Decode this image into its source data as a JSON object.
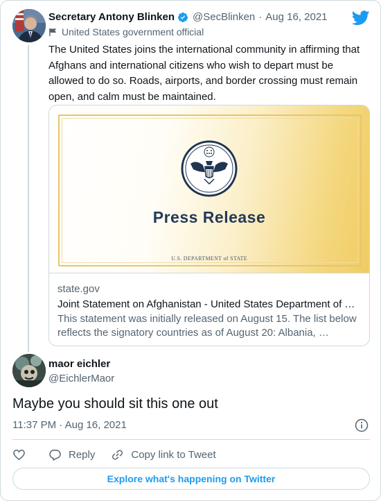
{
  "colors": {
    "brand_blue": "#1d9bf0",
    "text_primary": "#0f1419",
    "text_secondary": "#536471",
    "border": "#cfd9de",
    "press_navy": "#243a57",
    "frame_gold": "#e8c56b"
  },
  "parent_tweet": {
    "author_name": "Secretary Antony Blinken",
    "handle": "@SecBlinken",
    "date_prefix": "·",
    "date": "Aug 16, 2021",
    "verified_icon": "verified-badge-icon",
    "label_icon": "flag-icon",
    "label": "United States government official",
    "text": "The United States joins the international community in affirming that Afghans and international citizens who wish to depart must be allowed to do so. Roads, airports, and border crossing must remain open, and calm must be maintained.",
    "link_card": {
      "image_heading": "Press Release",
      "image_footer": "U.S. DEPARTMENT of STATE",
      "domain": "state.gov",
      "title": "Joint Statement on Afghanistan - United States Department of …",
      "description": "This statement was initially released on August 15. The list below reflects the signatory countries as of August 20:  Albania, …"
    }
  },
  "reply_tweet": {
    "author_name": "maor eichler",
    "handle": "@EichlerMaor",
    "text": "Maybe you should sit this one out",
    "timestamp": "11:37 PM · Aug 16, 2021",
    "info_icon": "info-icon"
  },
  "actions": {
    "like_icon": "heart-icon",
    "reply_icon": "reply-bubble-icon",
    "reply_label": "Reply",
    "copy_icon": "link-icon",
    "copy_label": "Copy link to Tweet"
  },
  "explore_button": "Explore what's happening on Twitter",
  "brand_icon": "twitter-bird-icon"
}
